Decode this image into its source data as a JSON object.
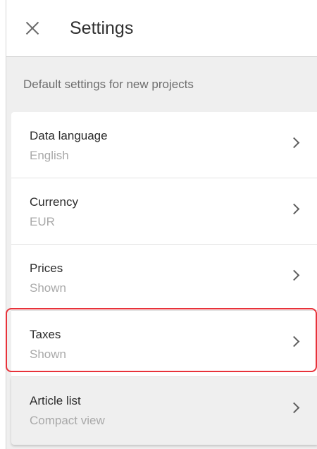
{
  "header": {
    "title": "Settings",
    "close_icon": "close-icon"
  },
  "subtitle": "Default settings for new projects",
  "items": [
    {
      "label": "Data language",
      "value": "English",
      "icon": "chevron-right-icon"
    },
    {
      "label": "Currency",
      "value": "EUR",
      "icon": "chevron-right-icon"
    },
    {
      "label": "Prices",
      "value": "Shown",
      "icon": "chevron-right-icon"
    },
    {
      "label": "Taxes",
      "value": "Shown",
      "icon": "chevron-right-icon"
    },
    {
      "label": "Article list",
      "value": "Compact view",
      "icon": "chevron-right-icon"
    }
  ],
  "colors": {
    "highlight": "#e8323a",
    "panel_bg": "#efefef",
    "label": "#2b2b2b",
    "value": "#a9a9a9"
  }
}
